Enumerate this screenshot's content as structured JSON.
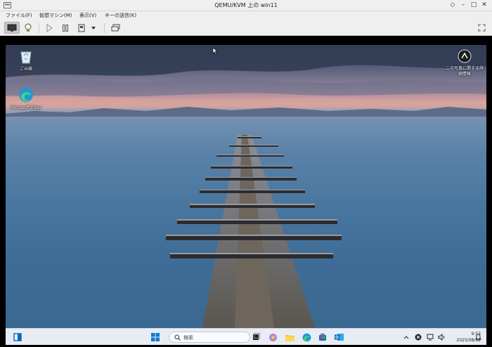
{
  "window": {
    "title": "QEMU/KVM 上の win11",
    "controls": {
      "minimize": "–",
      "maximize": "□",
      "close": "✕",
      "extra": "◇"
    }
  },
  "menubar": {
    "items": [
      "ファイル(F)",
      "仮想マシン(M)",
      "表示(V)",
      "キーの送信(K)"
    ]
  },
  "toolbar": {
    "buttons": [
      {
        "name": "console",
        "icon": "monitor-icon"
      },
      {
        "name": "details",
        "icon": "lightbulb-icon"
      },
      {
        "name": "run",
        "icon": "play-icon"
      },
      {
        "name": "pause",
        "icon": "pause-icon"
      },
      {
        "name": "shutdown",
        "icon": "power-icon"
      },
      {
        "name": "shutdown-menu",
        "icon": "dropdown-arrow-icon"
      },
      {
        "name": "snapshots",
        "icon": "snapshot-icon"
      },
      {
        "name": "fullscreen",
        "icon": "fullscreen-icon"
      }
    ]
  },
  "desktop": {
    "icons": {
      "recycle_bin": "ごみ箱",
      "edge": "Microsoft Edge",
      "learn_about": "この写真に関する詳細情報"
    }
  },
  "taskbar": {
    "search_placeholder": "検索",
    "time": "9:53",
    "date": "2025/08/11"
  },
  "colors": {
    "accent": "#0067c0",
    "taskbar_bg": "#e8edf5",
    "chrome_bg": "#efefef"
  }
}
